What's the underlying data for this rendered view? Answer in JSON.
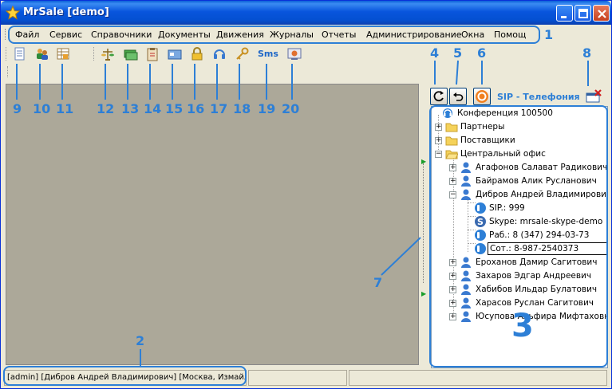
{
  "window": {
    "title": "MrSale [demo]",
    "icon": "star-icon",
    "controls": [
      "minimize-icon",
      "maximize-icon",
      "close-icon"
    ]
  },
  "menu": {
    "items": [
      "Файл",
      "Сервис",
      "Справочники",
      "Документы",
      "Движения",
      "Журналы",
      "Отчеты",
      "Администрирование",
      "Окна",
      "Помощь"
    ]
  },
  "toolbar": {
    "sms_label": "Sms"
  },
  "panel": {
    "title": "SIP - Телефония",
    "buttons": [
      "refresh-icon",
      "undo-icon",
      "sip-target-icon",
      "close-panel-icon"
    ]
  },
  "tree": {
    "conference": "Конференция 100500",
    "folders": [
      "Партнеры",
      "Поставщики",
      "Центральный офис"
    ],
    "employees": [
      "Агафонов Салават Радикович",
      "Байрамов Алик Русланович",
      "Дибров Андрей Владимирович",
      "Ероханов Дамир Сагитович",
      "Захаров Эдгар Андреевич",
      "Хабибов Ильдар Булатович",
      "Харасов  Руслан  Сагитович",
      "Юсупова Альфира Мифтаховна"
    ],
    "contacts": [
      "SIP.: 999",
      "Skype: mrsale-skype-demo",
      "Раб.: 8 (347) 294-03-73",
      "Сот.: 8-987-2540373"
    ]
  },
  "statusbar": {
    "user": "[admin] [Дибров Андрей Владимирович] [Москва, Измайлов"
  },
  "annotations": {
    "menu": "1",
    "status": "2",
    "tree": "3",
    "panel_buttons": [
      "4",
      "5",
      "6",
      "8"
    ],
    "splitter": "7",
    "toolbar_numbers": [
      "9",
      "10",
      "11",
      "12",
      "13",
      "14",
      "15",
      "16",
      "17",
      "18",
      "19",
      "20"
    ]
  },
  "colors": {
    "annotation": "#2d7fd6",
    "titlebar": "#0855dd"
  }
}
